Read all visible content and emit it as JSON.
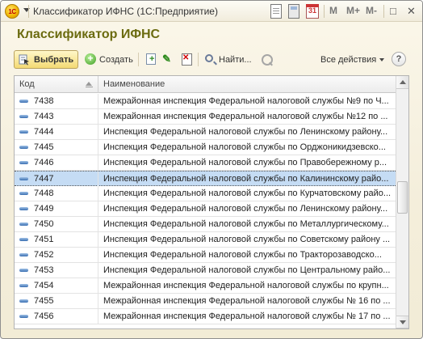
{
  "window": {
    "title": "Классификатор ИФНС  (1С:Предприятие)",
    "logo_text": "1С",
    "calendar_day": "31",
    "m_buttons": [
      "M",
      "M+",
      "M-"
    ],
    "controls": {
      "minimize": "–",
      "restore": "□",
      "close": "✕"
    }
  },
  "form": {
    "title": "Классификатор ИФНС"
  },
  "toolbar": {
    "select_label": "Выбрать",
    "create_label": "Создать",
    "find_label": "Найти...",
    "actions_label": "Все действия",
    "help_label": "?"
  },
  "grid": {
    "columns": {
      "code": "Код",
      "name": "Наименование"
    },
    "rows": [
      {
        "code": "7438",
        "name": "Межрайонная инспекция Федеральной налоговой службы №9 по Ч..."
      },
      {
        "code": "7443",
        "name": "Межрайонная инспекция Федеральной налоговой службы №12 по ..."
      },
      {
        "code": "7444",
        "name": "Инспекция Федеральной налоговой службы по Ленинскому району..."
      },
      {
        "code": "7445",
        "name": "Инспекция Федеральной налоговой службы по Орджоникидзевско..."
      },
      {
        "code": "7446",
        "name": "Инспекция Федеральной налоговой службы по Правобережному р..."
      },
      {
        "code": "7447",
        "name": "Инспекция Федеральной налоговой службы по Калининскому райо..."
      },
      {
        "code": "7448",
        "name": "Инспекция Федеральной налоговой службы по Курчатовскому райо..."
      },
      {
        "code": "7449",
        "name": "Инспекция Федеральной налоговой службы по Ленинскому району..."
      },
      {
        "code": "7450",
        "name": "Инспекция Федеральной налоговой службы по Металлургическому..."
      },
      {
        "code": "7451",
        "name": "Инспекция Федеральной налоговой службы по Советскому району ..."
      },
      {
        "code": "7452",
        "name": "Инспекция Федеральной налоговой службы по Тракторозаводско..."
      },
      {
        "code": "7453",
        "name": "Инспекция Федеральной налоговой службы по Центральному райо..."
      },
      {
        "code": "7454",
        "name": "Межрайонная инспекция Федеральной налоговой службы по крупн..."
      },
      {
        "code": "7455",
        "name": "Межрайонная инспекция Федеральной налоговой службы № 16 по ..."
      },
      {
        "code": "7456",
        "name": "Межрайонная инспекция Федеральной налоговой службы № 17 по ..."
      }
    ],
    "selected_code": "7447"
  },
  "colors": {
    "title_accent": "#6b6b0f",
    "selected_row": "#c5dcf4",
    "select_button": "#f4da74"
  }
}
